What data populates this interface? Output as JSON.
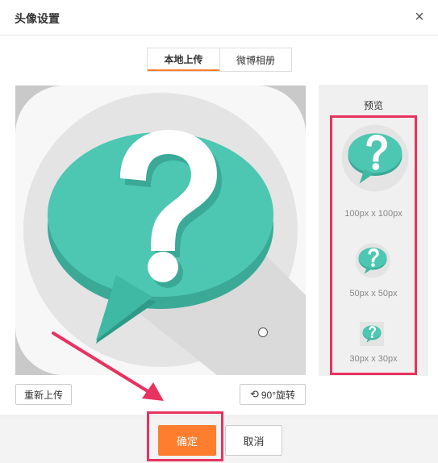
{
  "dialog": {
    "title": "头像设置",
    "close_symbol": "×"
  },
  "tabs": [
    {
      "label": "本地上传",
      "active": true
    },
    {
      "label": "微博相册",
      "active": false
    }
  ],
  "preview": {
    "title": "预览",
    "sizes": [
      {
        "label": "100px x 100px"
      },
      {
        "label": "50px x 50px"
      },
      {
        "label": "30px x 30px"
      }
    ]
  },
  "actions": {
    "reupload_label": "重新上传",
    "rotate_label": "90°旋转",
    "confirm_label": "确定",
    "cancel_label": "取消"
  },
  "colors": {
    "accent": "#ff7d2e",
    "highlight": "#e8325f",
    "bubble": "#4dc6b2",
    "bubble_shadow": "#3aa996"
  },
  "icons": {
    "close": "close-icon",
    "rotate": "rotate-icon",
    "avatar": "question-bubble-icon"
  }
}
